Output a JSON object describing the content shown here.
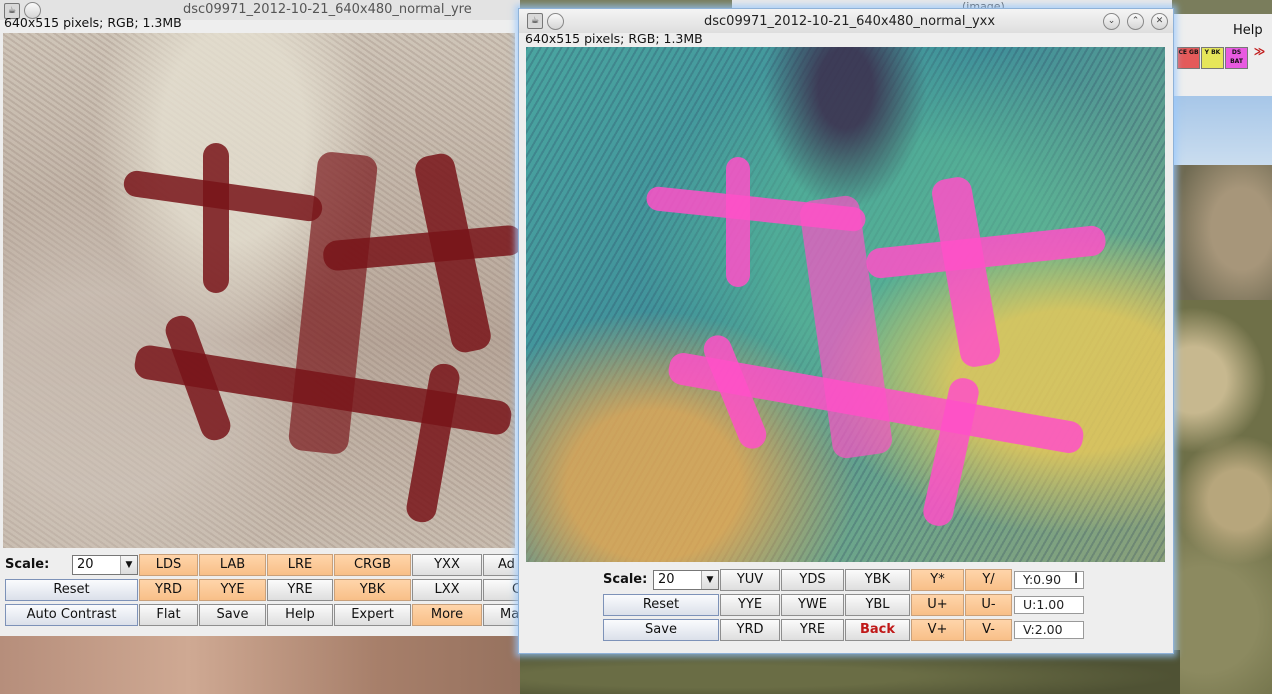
{
  "left_window": {
    "title": "dsc09971_2012-10-21_640x480_normal_yre",
    "info": "640x515 pixels; RGB; 1.3MB",
    "scale_label": "Scale:",
    "scale_value": "20",
    "rows": [
      [
        "LDS",
        "LAB",
        "LRE",
        "CRGB",
        "YXX",
        "Ad"
      ],
      [
        "Reset",
        "YRD",
        "YYE",
        "YRE",
        "YBK",
        "LXX",
        "C"
      ],
      [
        "Auto Contrast",
        "Flat",
        "Save",
        "Help",
        "Expert",
        "More",
        "Ma"
      ]
    ]
  },
  "right_window": {
    "title": "dsc09971_2012-10-21_640x480_normal_yxx",
    "info": "640x515 pixels; RGB; 1.3MB",
    "scale_label": "Scale:",
    "scale_value": "20",
    "row1": [
      "YUV",
      "YDS",
      "YBK",
      "Y*",
      "Y/"
    ],
    "row2": [
      "Reset",
      "YYE",
      "YWE",
      "YBL",
      "U+",
      "U-"
    ],
    "row3": [
      "Save",
      "YRD",
      "YRE",
      "Back",
      "V+",
      "V-"
    ],
    "fields": {
      "y": "Y:0.90",
      "u": "U:1.00",
      "v": "V:2.00"
    }
  },
  "background_window": {
    "title": "(image)",
    "menu_help": "Help",
    "mini_buttons": [
      "CE GB",
      "Y BK",
      "DS BAT",
      "≫"
    ]
  },
  "colors": {
    "orange_button": "#f8bf88",
    "accent_red": "#c01818"
  }
}
